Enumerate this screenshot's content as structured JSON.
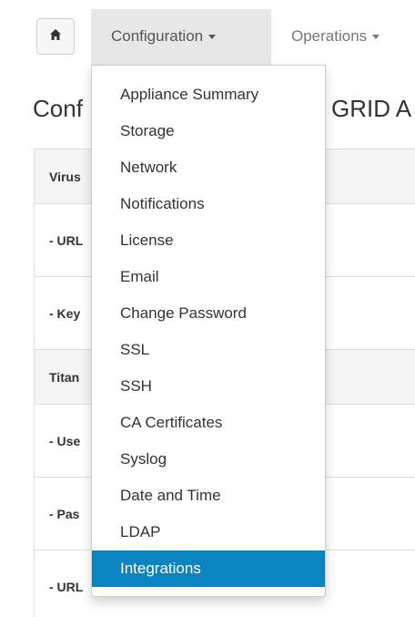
{
  "navbar": {
    "home_icon": "home-icon",
    "configuration_label": "Configuration",
    "operations_label": "Operations"
  },
  "heading": {
    "left_fragment": "Conf",
    "right_fragment": "GRID A"
  },
  "table": {
    "rows": [
      {
        "kind": "section",
        "label": "Virus"
      },
      {
        "kind": "field",
        "label": "- URL"
      },
      {
        "kind": "field",
        "label": "- Key"
      },
      {
        "kind": "section",
        "label": "Titan"
      },
      {
        "kind": "field",
        "label": "- Use"
      },
      {
        "kind": "field",
        "label": "- Pas"
      },
      {
        "kind": "field",
        "label": "- URL"
      }
    ]
  },
  "dropdown": {
    "items": [
      {
        "label": "Appliance Summary"
      },
      {
        "label": "Storage"
      },
      {
        "label": "Network"
      },
      {
        "label": "Notifications"
      },
      {
        "label": "License"
      },
      {
        "label": "Email"
      },
      {
        "label": "Change Password"
      },
      {
        "label": "SSL"
      },
      {
        "label": "SSH"
      },
      {
        "label": "CA Certificates"
      },
      {
        "label": "Syslog"
      },
      {
        "label": "Date and Time"
      },
      {
        "label": "LDAP"
      },
      {
        "label": "Integrations"
      }
    ],
    "active_label": "Integrations"
  },
  "colors": {
    "active_item_bg": "#0a85c2",
    "nav_active_bg": "#e7e7e7"
  }
}
